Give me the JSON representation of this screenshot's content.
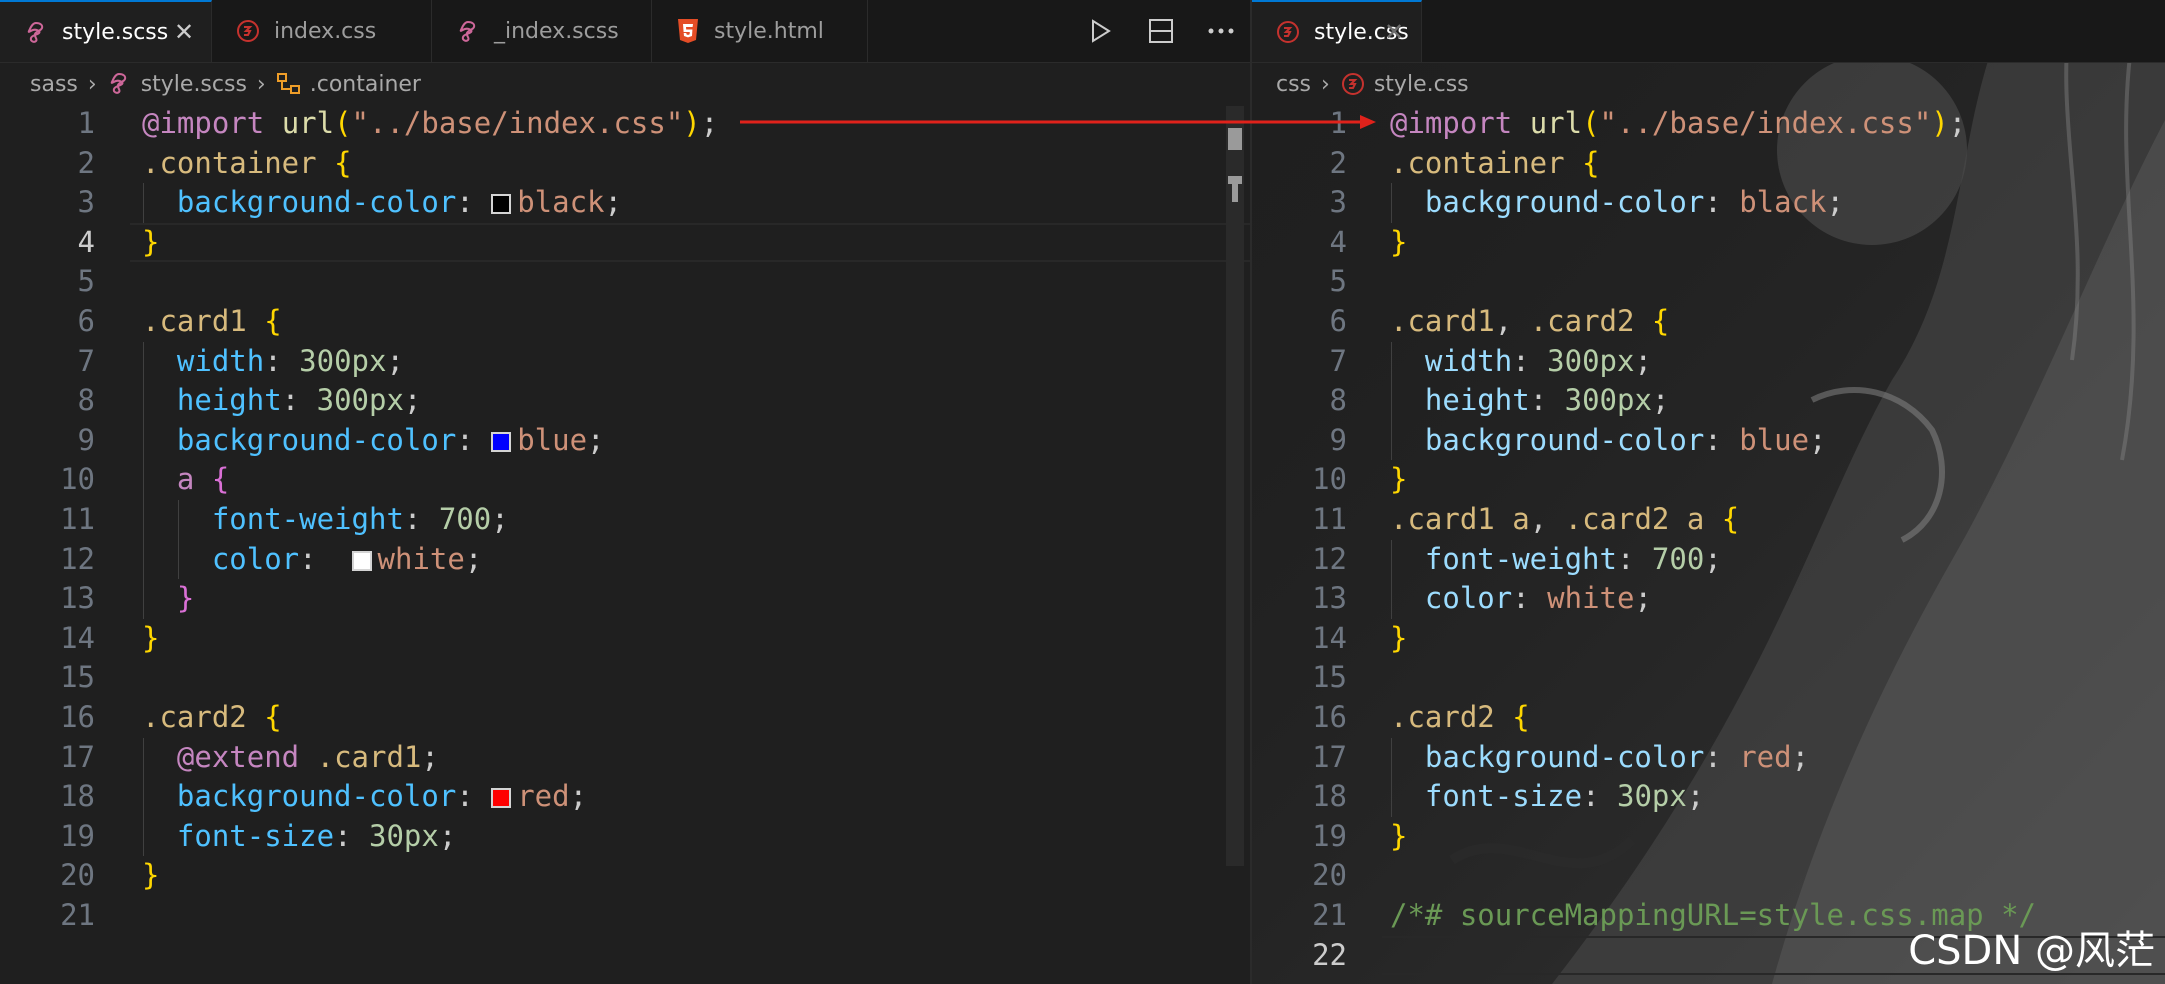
{
  "left": {
    "tabs": [
      {
        "label": "style.scss",
        "icon": "sass-icon",
        "active": true
      },
      {
        "label": "index.css",
        "icon": "css-icon",
        "active": false
      },
      {
        "label": "_index.scss",
        "icon": "sass-icon",
        "active": false
      },
      {
        "label": "style.html",
        "icon": "html5-icon",
        "active": false
      }
    ],
    "breadcrumb": [
      "sass",
      "style.scss",
      ".container"
    ],
    "lines": [
      {
        "n": "1",
        "segs": [
          [
            "tk-at",
            "@import"
          ],
          [
            "tk-p",
            " "
          ],
          [
            "tk-fn",
            "url"
          ],
          [
            "tk-br1",
            "("
          ],
          [
            "tk-str",
            "\"../base/index.css\""
          ],
          [
            "tk-br1",
            ")"
          ],
          [
            "tk-p",
            ";"
          ]
        ]
      },
      {
        "n": "2",
        "segs": [
          [
            "tk-sel",
            ".container"
          ],
          [
            "tk-p",
            " "
          ],
          [
            "tk-br1",
            "{"
          ]
        ]
      },
      {
        "n": "3",
        "segs": [
          [
            "tk-p",
            "  "
          ],
          [
            "tk-prop2",
            "background-color"
          ],
          [
            "tk-p",
            ": "
          ],
          [
            "sw",
            "#000000"
          ],
          [
            "tk-val",
            "black"
          ],
          [
            "tk-p",
            ";"
          ]
        ]
      },
      {
        "n": "4",
        "segs": [
          [
            "tk-br1",
            "}"
          ]
        ]
      },
      {
        "n": "5",
        "segs": []
      },
      {
        "n": "6",
        "segs": [
          [
            "tk-sel",
            ".card1"
          ],
          [
            "tk-p",
            " "
          ],
          [
            "tk-br1",
            "{"
          ]
        ]
      },
      {
        "n": "7",
        "segs": [
          [
            "tk-p",
            "  "
          ],
          [
            "tk-prop2",
            "width"
          ],
          [
            "tk-p",
            ": "
          ],
          [
            "tk-num",
            "300px"
          ],
          [
            "tk-p",
            ";"
          ]
        ]
      },
      {
        "n": "8",
        "segs": [
          [
            "tk-p",
            "  "
          ],
          [
            "tk-prop2",
            "height"
          ],
          [
            "tk-p",
            ": "
          ],
          [
            "tk-num",
            "300px"
          ],
          [
            "tk-p",
            ";"
          ]
        ]
      },
      {
        "n": "9",
        "segs": [
          [
            "tk-p",
            "  "
          ],
          [
            "tk-prop2",
            "background-color"
          ],
          [
            "tk-p",
            ": "
          ],
          [
            "sw",
            "#0000ff"
          ],
          [
            "tk-val",
            "blue"
          ],
          [
            "tk-p",
            ";"
          ]
        ]
      },
      {
        "n": "10",
        "segs": [
          [
            "tk-p",
            "  "
          ],
          [
            "tk-kw",
            "a"
          ],
          [
            "tk-p",
            " "
          ],
          [
            "tk-br2",
            "{"
          ]
        ]
      },
      {
        "n": "11",
        "segs": [
          [
            "tk-p",
            "    "
          ],
          [
            "tk-prop2",
            "font-weight"
          ],
          [
            "tk-p",
            ": "
          ],
          [
            "tk-num",
            "700"
          ],
          [
            "tk-p",
            ";"
          ]
        ]
      },
      {
        "n": "12",
        "segs": [
          [
            "tk-p",
            "    "
          ],
          [
            "tk-prop2",
            "color"
          ],
          [
            "tk-p",
            ":  "
          ],
          [
            "sw",
            "#ffffff"
          ],
          [
            "tk-val",
            "white"
          ],
          [
            "tk-p",
            ";"
          ]
        ]
      },
      {
        "n": "13",
        "segs": [
          [
            "tk-p",
            "  "
          ],
          [
            "tk-br2",
            "}"
          ]
        ]
      },
      {
        "n": "14",
        "segs": [
          [
            "tk-br1",
            "}"
          ]
        ]
      },
      {
        "n": "15",
        "segs": []
      },
      {
        "n": "16",
        "segs": [
          [
            "tk-sel",
            ".card2"
          ],
          [
            "tk-p",
            " "
          ],
          [
            "tk-br1",
            "{"
          ]
        ]
      },
      {
        "n": "17",
        "segs": [
          [
            "tk-p",
            "  "
          ],
          [
            "tk-at",
            "@extend"
          ],
          [
            "tk-p",
            " "
          ],
          [
            "tk-sel",
            ".card1"
          ],
          [
            "tk-p",
            ";"
          ]
        ]
      },
      {
        "n": "18",
        "segs": [
          [
            "tk-p",
            "  "
          ],
          [
            "tk-prop2",
            "background-color"
          ],
          [
            "tk-p",
            ": "
          ],
          [
            "sw",
            "#ff0000"
          ],
          [
            "tk-val",
            "red"
          ],
          [
            "tk-p",
            ";"
          ]
        ]
      },
      {
        "n": "19",
        "segs": [
          [
            "tk-p",
            "  "
          ],
          [
            "tk-prop2",
            "font-size"
          ],
          [
            "tk-p",
            ": "
          ],
          [
            "tk-num",
            "30px"
          ],
          [
            "tk-p",
            ";"
          ]
        ]
      },
      {
        "n": "20",
        "segs": [
          [
            "tk-br1",
            "}"
          ]
        ]
      },
      {
        "n": "21",
        "segs": []
      }
    ],
    "current_line": "4"
  },
  "right": {
    "tabs": [
      {
        "label": "style.css",
        "icon": "css-icon",
        "active": true
      }
    ],
    "breadcrumb": [
      "css",
      "style.css"
    ],
    "lines": [
      {
        "n": "1",
        "segs": [
          [
            "tk-at",
            "@import"
          ],
          [
            "tk-p",
            " "
          ],
          [
            "tk-fn",
            "url"
          ],
          [
            "tk-br1",
            "("
          ],
          [
            "tk-str",
            "\"../base/index.css\""
          ],
          [
            "tk-br1",
            ")"
          ],
          [
            "tk-p",
            ";"
          ]
        ]
      },
      {
        "n": "2",
        "segs": [
          [
            "tk-sel",
            ".container"
          ],
          [
            "tk-p",
            " "
          ],
          [
            "tk-br1",
            "{"
          ]
        ]
      },
      {
        "n": "3",
        "segs": [
          [
            "tk-p",
            "  "
          ],
          [
            "tk-prop",
            "background-color"
          ],
          [
            "tk-p",
            ": "
          ],
          [
            "tk-val",
            "black"
          ],
          [
            "tk-p",
            ";"
          ]
        ]
      },
      {
        "n": "4",
        "segs": [
          [
            "tk-br1",
            "}"
          ]
        ]
      },
      {
        "n": "5",
        "segs": []
      },
      {
        "n": "6",
        "segs": [
          [
            "tk-sel",
            ".card1"
          ],
          [
            "tk-p",
            ", "
          ],
          [
            "tk-sel",
            ".card2"
          ],
          [
            "tk-p",
            " "
          ],
          [
            "tk-br1",
            "{"
          ]
        ]
      },
      {
        "n": "7",
        "segs": [
          [
            "tk-p",
            "  "
          ],
          [
            "tk-prop",
            "width"
          ],
          [
            "tk-p",
            ": "
          ],
          [
            "tk-num",
            "300px"
          ],
          [
            "tk-p",
            ";"
          ]
        ]
      },
      {
        "n": "8",
        "segs": [
          [
            "tk-p",
            "  "
          ],
          [
            "tk-prop",
            "height"
          ],
          [
            "tk-p",
            ": "
          ],
          [
            "tk-num",
            "300px"
          ],
          [
            "tk-p",
            ";"
          ]
        ]
      },
      {
        "n": "9",
        "segs": [
          [
            "tk-p",
            "  "
          ],
          [
            "tk-prop",
            "background-color"
          ],
          [
            "tk-p",
            ": "
          ],
          [
            "tk-val",
            "blue"
          ],
          [
            "tk-p",
            ";"
          ]
        ]
      },
      {
        "n": "10",
        "segs": [
          [
            "tk-br1",
            "}"
          ]
        ]
      },
      {
        "n": "11",
        "segs": [
          [
            "tk-sel",
            ".card1"
          ],
          [
            "tk-p",
            " "
          ],
          [
            "tk-tag",
            "a"
          ],
          [
            "tk-p",
            ", "
          ],
          [
            "tk-sel",
            ".card2"
          ],
          [
            "tk-p",
            " "
          ],
          [
            "tk-tag",
            "a"
          ],
          [
            "tk-p",
            " "
          ],
          [
            "tk-br1",
            "{"
          ]
        ]
      },
      {
        "n": "12",
        "segs": [
          [
            "tk-p",
            "  "
          ],
          [
            "tk-prop",
            "font-weight"
          ],
          [
            "tk-p",
            ": "
          ],
          [
            "tk-num",
            "700"
          ],
          [
            "tk-p",
            ";"
          ]
        ]
      },
      {
        "n": "13",
        "segs": [
          [
            "tk-p",
            "  "
          ],
          [
            "tk-prop",
            "color"
          ],
          [
            "tk-p",
            ": "
          ],
          [
            "tk-val",
            "white"
          ],
          [
            "tk-p",
            ";"
          ]
        ]
      },
      {
        "n": "14",
        "segs": [
          [
            "tk-br1",
            "}"
          ]
        ]
      },
      {
        "n": "15",
        "segs": []
      },
      {
        "n": "16",
        "segs": [
          [
            "tk-sel",
            ".card2"
          ],
          [
            "tk-p",
            " "
          ],
          [
            "tk-br1",
            "{"
          ]
        ]
      },
      {
        "n": "17",
        "segs": [
          [
            "tk-p",
            "  "
          ],
          [
            "tk-prop",
            "background-color"
          ],
          [
            "tk-p",
            ": "
          ],
          [
            "tk-val",
            "red"
          ],
          [
            "tk-p",
            ";"
          ]
        ]
      },
      {
        "n": "18",
        "segs": [
          [
            "tk-p",
            "  "
          ],
          [
            "tk-prop",
            "font-size"
          ],
          [
            "tk-p",
            ": "
          ],
          [
            "tk-num",
            "30px"
          ],
          [
            "tk-p",
            ";"
          ]
        ]
      },
      {
        "n": "19",
        "segs": [
          [
            "tk-br1",
            "}"
          ]
        ]
      },
      {
        "n": "20",
        "segs": []
      },
      {
        "n": "21",
        "segs": [
          [
            "tk-cm",
            "/*# sourceMappingURL=style.css.map */"
          ]
        ]
      },
      {
        "n": "22",
        "segs": []
      }
    ],
    "current_line": "22"
  },
  "watermark": "CSDN @风茫",
  "colors": {
    "accent": "#0078d4",
    "arrow": "#e0221b",
    "editor_bg": "#1f1f1f",
    "tabbar_bg": "#181818"
  }
}
